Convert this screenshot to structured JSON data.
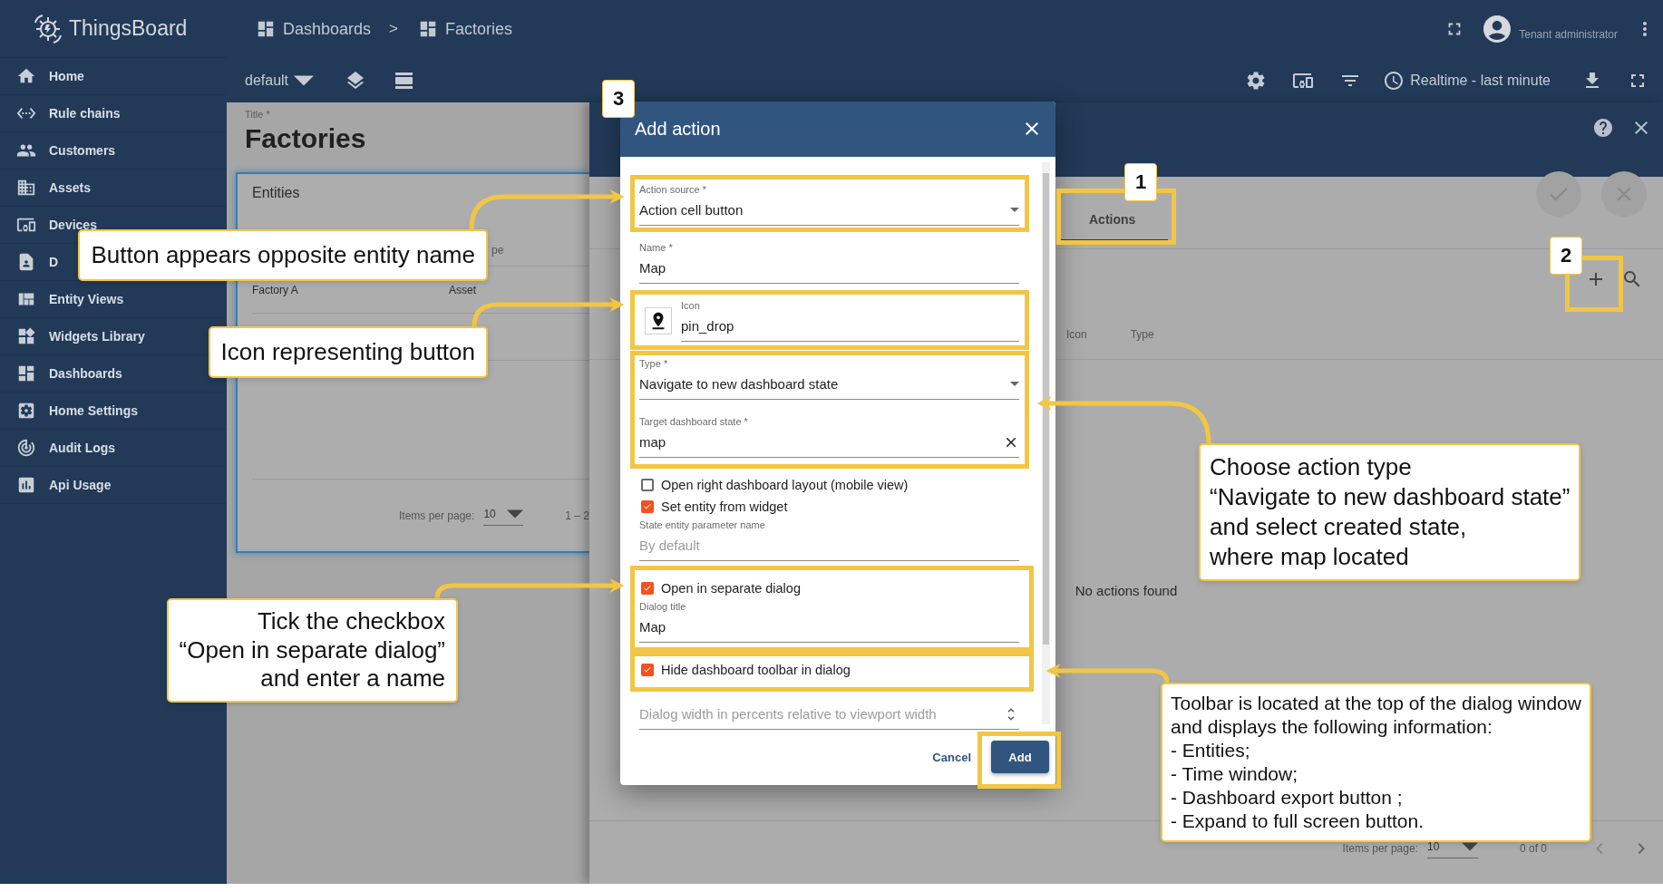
{
  "header": {
    "brand": "ThingsBoard",
    "breadcrumbs": [
      {
        "label": "Dashboards"
      },
      {
        "label": "Factories"
      }
    ],
    "separator": ">",
    "user": "Tenant administrator"
  },
  "sidebar": {
    "items": [
      {
        "label": "Home"
      },
      {
        "label": "Rule chains"
      },
      {
        "label": "Customers"
      },
      {
        "label": "Assets"
      },
      {
        "label": "Devices"
      },
      {
        "label": "D"
      },
      {
        "label": "Entity Views"
      },
      {
        "label": "Widgets Library"
      },
      {
        "label": "Dashboards"
      },
      {
        "label": "Home Settings"
      },
      {
        "label": "Audit Logs"
      },
      {
        "label": "Api Usage"
      }
    ]
  },
  "toolbar": {
    "state": "default",
    "timewindow": "Realtime - last minute"
  },
  "dashboard": {
    "title_label": "Title *",
    "title": "Factories",
    "widget": {
      "title": "Entities",
      "column_fragment": "pe",
      "rows": [
        {
          "name": "Factory A",
          "type": "Asset"
        }
      ],
      "items_per_page_label": "Items per page:",
      "page_size": "10",
      "range": "1 – 2"
    }
  },
  "widget_editor": {
    "tabs": [
      {
        "label": "Actions",
        "selected": true
      }
    ],
    "columns": [
      "Icon",
      "Type"
    ],
    "empty_text": "No actions found",
    "items_per_page_label": "Items per page:",
    "page_size": "10",
    "range": "0 of 0"
  },
  "dialog": {
    "title": "Add action",
    "fields": [
      {
        "kind": "select",
        "label": "Action source *",
        "value": "Action cell button"
      },
      {
        "kind": "input",
        "label": "Name *",
        "value": "Map"
      },
      {
        "kind": "icon",
        "label": "Icon",
        "value": "pin_drop"
      },
      {
        "kind": "select",
        "label": "Type *",
        "value": "Navigate to new dashboard state"
      },
      {
        "kind": "clearable",
        "label": "Target dashboard state *",
        "value": "map"
      },
      {
        "kind": "checkbox",
        "label": "Open right dashboard layout (mobile view)",
        "checked": false
      },
      {
        "kind": "checkbox",
        "label": "Set entity from widget",
        "checked": true
      },
      {
        "kind": "input",
        "label": "State entity parameter name",
        "placeholder": "By default"
      },
      {
        "kind": "checkbox",
        "label": "Open in separate dialog",
        "checked": true
      },
      {
        "kind": "input",
        "label": "Dialog title",
        "value": "Map"
      },
      {
        "kind": "checkbox",
        "label": "Hide dashboard toolbar in dialog",
        "checked": true
      },
      {
        "kind": "number",
        "placeholder": "Dialog width in percents relative to viewport width"
      }
    ],
    "cancel": "Cancel",
    "submit": "Add"
  },
  "annotations": {
    "badges": [
      {
        "number": "1"
      },
      {
        "number": "2"
      },
      {
        "number": "3"
      }
    ],
    "notes": [
      {
        "text": "Button appears opposite entity name"
      },
      {
        "text": "Icon representing button"
      },
      {
        "text": "Tick the checkbox\n“Open in separate dialog”\nand enter a name"
      },
      {
        "text": "Choose action type\n“Navigate to new dashboard state”\nand select created state,\nwhere map located"
      },
      {
        "text": "Toolbar is located at the top of the dialog window\nand displays the following information:\n- Entities;\n- Time window;\n- Dashboard export button ;\n- Expand to full screen button."
      }
    ]
  }
}
